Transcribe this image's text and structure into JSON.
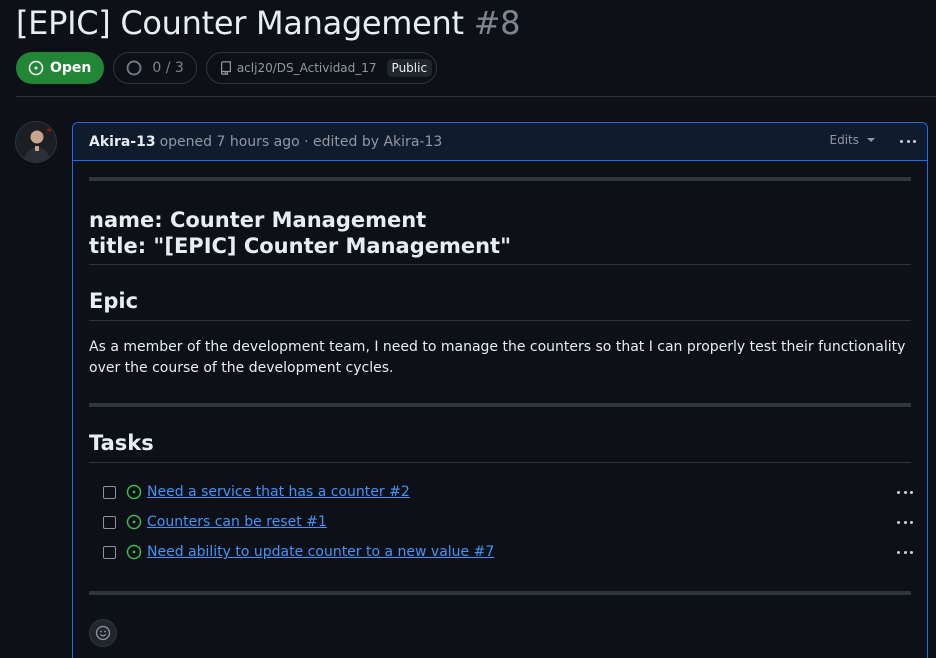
{
  "issue": {
    "title": "[EPIC] Counter Management",
    "number": "#8",
    "state": "Open",
    "progress": "0 / 3",
    "repo": "aclj20/DS_Actividad_17",
    "visibility": "Public"
  },
  "comment": {
    "author": "Akira-13",
    "action_text": "opened 7 hours ago · edited by Akira-13",
    "edits_label": "Edits",
    "frontmatter_line1": "name: Counter Management",
    "frontmatter_line2": "title: \"[EPIC] Counter Management\"",
    "epic_heading": "Epic",
    "epic_text": "As a member of the development team, I need to manage the counters so that I can properly test their functionality over the course of the development cycles.",
    "tasks_heading": "Tasks",
    "tasks": [
      {
        "label": "Need a service that has a counter #2",
        "checked": false
      },
      {
        "label": "Counters can be reset #1",
        "checked": false
      },
      {
        "label": "Need ability to update counter to a new value #7",
        "checked": false
      }
    ]
  },
  "colors": {
    "open_green": "#238636",
    "link_blue": "#4493f8",
    "focus_border": "#1f6feb",
    "open_icon_green": "#3fb950"
  },
  "icons": {
    "state": "issue-opened-icon",
    "progress": "circle-progress-icon",
    "repo": "repo-icon",
    "reaction": "smiley-icon"
  }
}
